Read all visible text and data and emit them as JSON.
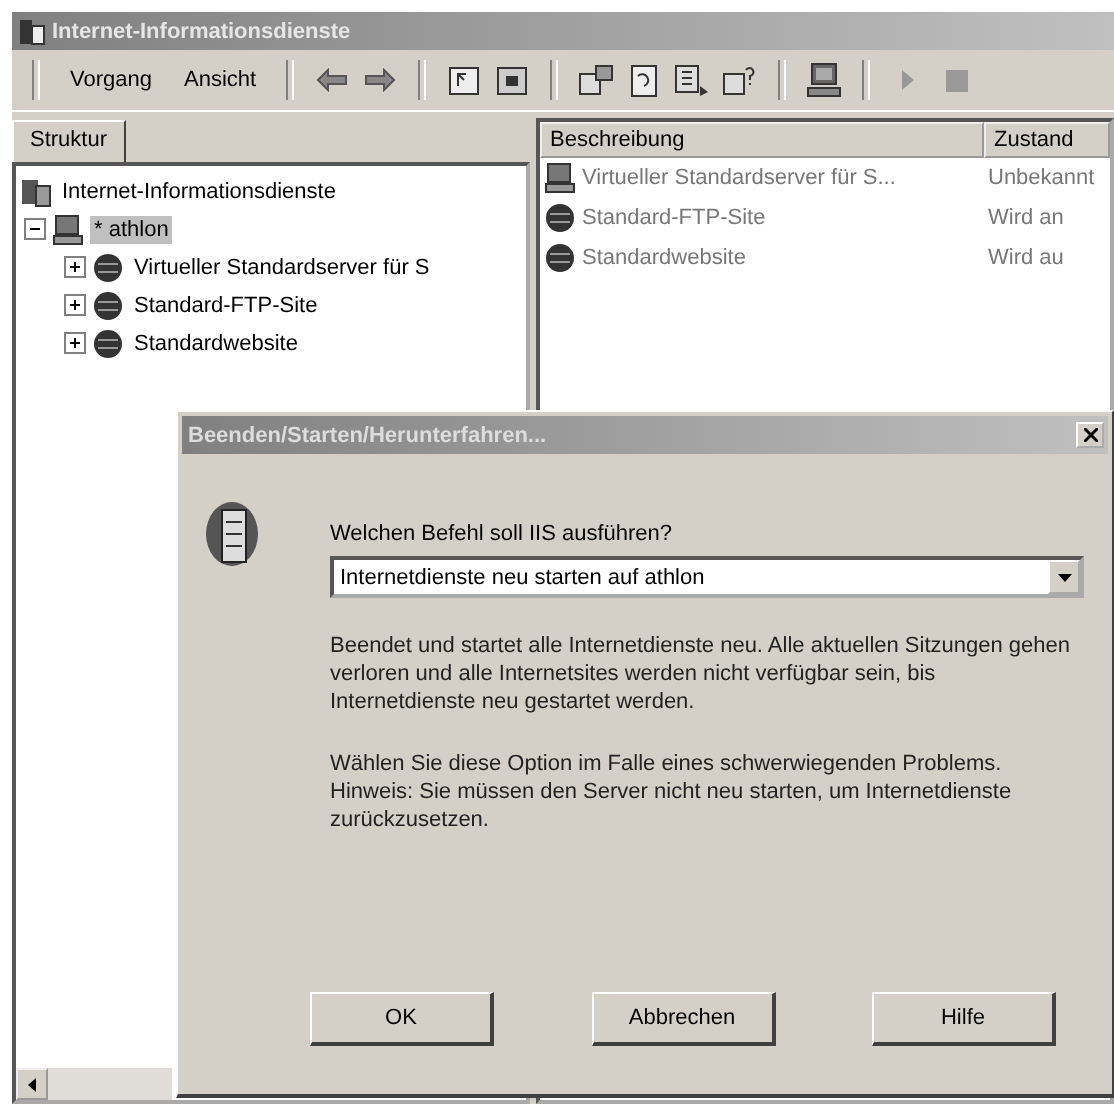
{
  "window": {
    "title": "Internet-Informationsdienste"
  },
  "menu": [
    {
      "label": "Vorgang"
    },
    {
      "label": "Ansicht"
    }
  ],
  "tabs": [
    {
      "label": "Struktur",
      "selected": true
    }
  ],
  "tree": [
    {
      "label": "Internet-Informationsdienste",
      "selected": false,
      "children": [
        {
          "label": "* athlon",
          "expanded": true,
          "selected": true,
          "children": [
            {
              "label": "Virtueller Standardserver für S",
              "expanded": false,
              "selected": false
            },
            {
              "label": "Standard-FTP-Site",
              "expanded": false,
              "selected": false
            },
            {
              "label": "Standardwebsite",
              "expanded": false,
              "selected": false
            }
          ]
        }
      ]
    }
  ],
  "list": {
    "columns": [
      "Beschreibung",
      "Zustand"
    ],
    "rows": [
      {
        "cells": [
          "Virtueller Standardserver für S...",
          "Unbekannt"
        ]
      },
      {
        "cells": [
          "Standard-FTP-Site",
          "Wird an"
        ]
      },
      {
        "cells": [
          "Standardwebsite",
          "Wird au"
        ]
      }
    ]
  },
  "dialog": {
    "title": "Beenden/Starten/Herunterfahren...",
    "question": "Welchen Befehl soll IIS ausführen?",
    "select": {
      "value": "Internetdienste neu starten auf athlon"
    },
    "paragraphs": [
      "Beendet und startet alle Internetdienste neu. Alle aktuellen Sitzungen gehen verloren und alle Internetsites werden nicht verfügbar sein, bis Internetdienste neu gestartet werden.",
      "Wählen Sie diese Option im Falle eines schwerwiegenden Problems.  Hinweis: Sie müssen den Server nicht neu starten, um Internetdienste zurückzusetzen."
    ],
    "buttons": [
      "OK",
      "Abbrechen",
      "Hilfe"
    ]
  }
}
